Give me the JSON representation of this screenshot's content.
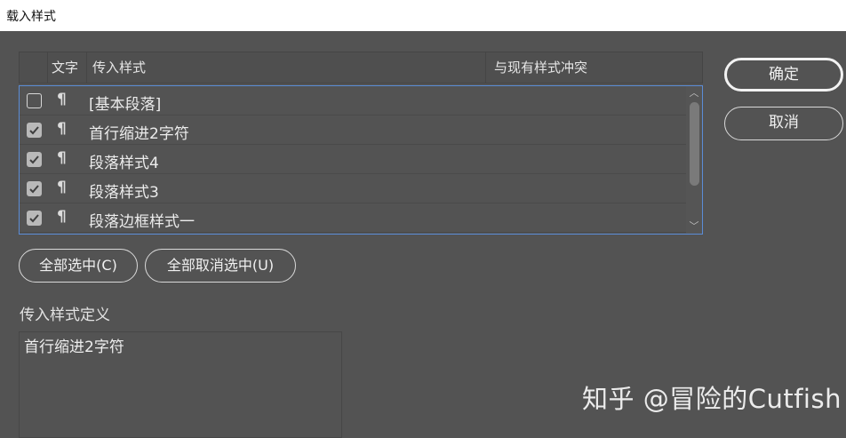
{
  "window": {
    "title": "载入样式"
  },
  "table": {
    "headers": {
      "text": "文字",
      "incoming": "传入样式",
      "conflict": "与现有样式冲突"
    },
    "rows": [
      {
        "checked": false,
        "icon": "paragraph-icon",
        "glyph": "¶",
        "label": "[基本段落]"
      },
      {
        "checked": true,
        "icon": "paragraph-icon",
        "glyph": "¶",
        "label": "首行缩进2字符"
      },
      {
        "checked": true,
        "icon": "paragraph-icon",
        "glyph": "¶",
        "label": "段落样式4"
      },
      {
        "checked": true,
        "icon": "paragraph-icon",
        "glyph": "¶",
        "label": "段落样式3"
      },
      {
        "checked": true,
        "icon": "paragraph-icon",
        "glyph": "¶",
        "label": "段落边框样式一"
      }
    ]
  },
  "buttons": {
    "ok": "确定",
    "cancel": "取消",
    "select_all": "全部选中(C)",
    "deselect_all": "全部取消选中(U)"
  },
  "definition": {
    "label": "传入样式定义",
    "value": "首行缩进2字符"
  },
  "watermark": "知乎 @冒险的Cutfish",
  "colors": {
    "background": "#535353",
    "titlebar": "#ffffff",
    "list_focus_border": "#5b8cd6",
    "checkbox_checked": "#b9b9b9"
  }
}
